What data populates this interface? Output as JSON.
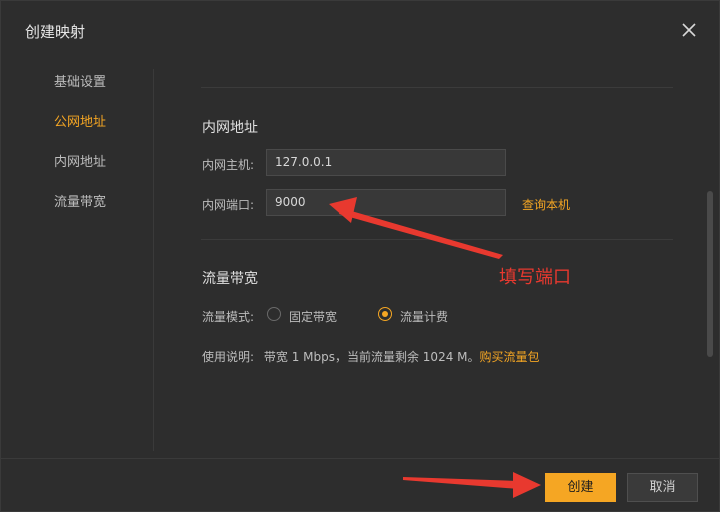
{
  "dialog": {
    "title": "创建映射"
  },
  "sidebar": {
    "items": [
      {
        "label": "基础设置",
        "active": false
      },
      {
        "label": "公网地址",
        "active": true
      },
      {
        "label": "内网地址",
        "active": false
      },
      {
        "label": "流量带宽",
        "active": false
      }
    ]
  },
  "internal_address": {
    "section_title": "内网地址",
    "host_label": "内网主机:",
    "host_value": "127.0.0.1",
    "port_label": "内网端口:",
    "port_value": "9000",
    "query_link": "查询本机"
  },
  "bandwidth": {
    "section_title": "流量带宽",
    "mode_label": "流量模式:",
    "options": [
      {
        "label": "固定带宽",
        "checked": false
      },
      {
        "label": "流量计费",
        "checked": true
      }
    ],
    "usage_label": "使用说明:",
    "usage_text": "带宽 1 Mbps，当前流量剩余 1024 M。",
    "buy_link": "购买流量包"
  },
  "annotation": {
    "text": "填写端口",
    "color": "#e8392f"
  },
  "footer": {
    "create_label": "创建",
    "cancel_label": "取消"
  },
  "colors": {
    "accent": "#f5a623",
    "background": "#2d2d2d"
  },
  "icons": {
    "close": "close-icon",
    "radio": "radio-icon"
  }
}
